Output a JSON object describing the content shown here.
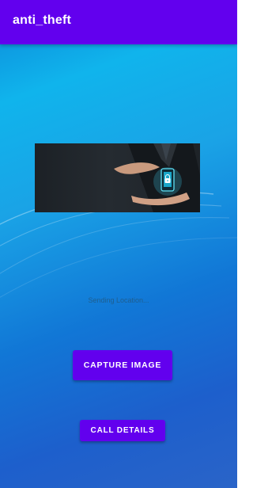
{
  "app_bar": {
    "title": "anti_theft",
    "color": "#6200ee"
  },
  "hero_image": {
    "icon": "phone-lock-icon"
  },
  "status": {
    "text": "Sending Location..."
  },
  "buttons": {
    "capture_image": "CAPTURE IMAGE",
    "call_details": "CALL DETAILS"
  }
}
